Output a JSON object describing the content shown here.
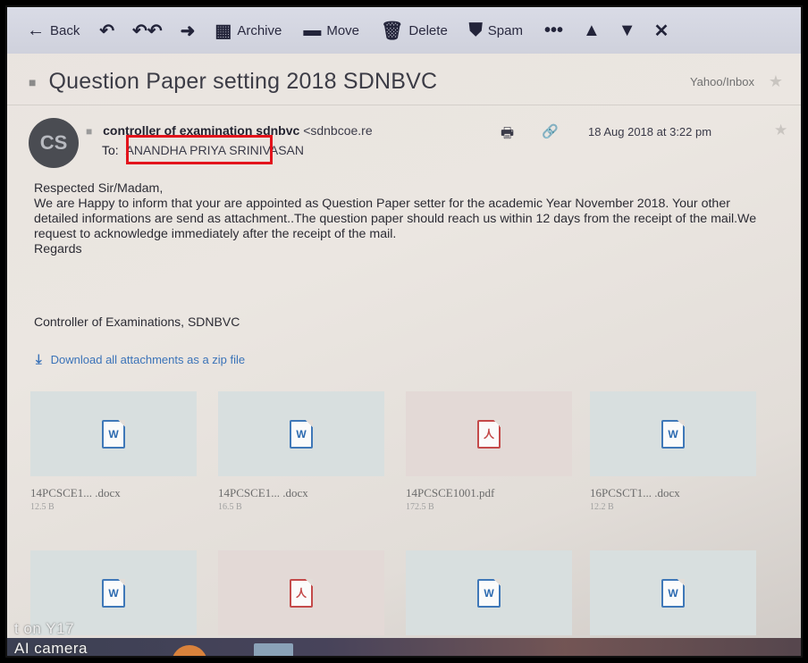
{
  "toolbar": {
    "back_label": "Back",
    "archive_label": "Archive",
    "move_label": "Move",
    "delete_label": "Delete",
    "spam_label": "Spam",
    "more_label": "•••"
  },
  "message": {
    "subject": "Question Paper setting 2018 SDNBVC",
    "folder": "Yahoo/Inbox",
    "avatar_initials": "CS",
    "sender_name": "controller of examination sdnbvc",
    "sender_email": "<sdnbcoe.re",
    "to_label": "To:",
    "recipient": "ANANDHA PRIYA SRINIVASAN",
    "date": "18 Aug 2018 at 3:22 pm",
    "body": "Respected Sir/Madam,\nWe are Happy to inform that your are appointed as Question Paper setter for the academic Year November 2018. Your other detailed informations  are send as attachment..The question paper should reach us within 12 days from the receipt of the mail.We request to acknowledge immediately after the receipt of the mail.\nRegards",
    "signature": "Controller of Examinations, SDNBVC"
  },
  "download_all_label": "Download all attachments as a zip file",
  "attachments": [
    {
      "name": "14PCSCE1...  .docx",
      "size": "12.5 B",
      "type": "doc",
      "glyph": "W"
    },
    {
      "name": "14PCSCE1...  .docx",
      "size": "16.5 B",
      "type": "doc",
      "glyph": "W"
    },
    {
      "name": "14PCSCE1001.pdf",
      "size": "172.5 B",
      "type": "pdf",
      "glyph": "人"
    },
    {
      "name": "16PCSCT1...  .docx",
      "size": "12.2 B",
      "type": "doc",
      "glyph": "W"
    },
    {
      "type": "doc",
      "glyph": "W"
    },
    {
      "type": "pdf",
      "glyph": "人"
    },
    {
      "type": "doc",
      "glyph": "W"
    },
    {
      "type": "doc",
      "glyph": "W"
    }
  ],
  "overlay": {
    "model_text": "t on Y17",
    "camera_text": "AI camera"
  },
  "colors": {
    "highlight": "#e3141c",
    "link": "#3b73b8"
  }
}
